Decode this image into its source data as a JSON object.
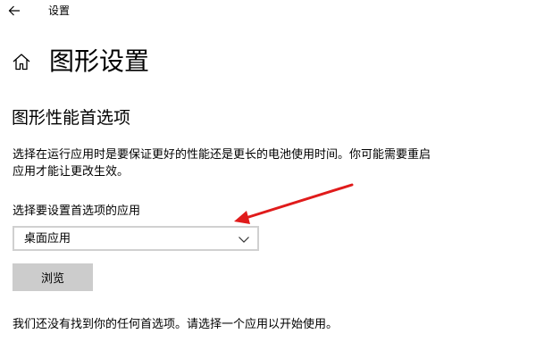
{
  "window": {
    "title": "设置"
  },
  "header": {
    "title": "图形设置"
  },
  "section": {
    "title": "图形性能首选项",
    "description": "选择在运行应用时是要保证更好的性能还是更长的电池使用时间。你可能需要重启应用才能让更改生效。"
  },
  "app_selector": {
    "label": "选择要设置首选项的应用",
    "selected": "桌面应用",
    "browse_label": "浏览"
  },
  "status": {
    "message": "我们还没有找到你的任何首选项。请选择一个应用以开始使用。"
  },
  "icons": {
    "back": "back-arrow-icon",
    "home": "home-icon",
    "dropdown": "chevron-down-icon"
  },
  "colors": {
    "annotation_arrow": "#e01b1b",
    "button_background": "#cccccc",
    "dropdown_border": "#d0d0d0"
  }
}
